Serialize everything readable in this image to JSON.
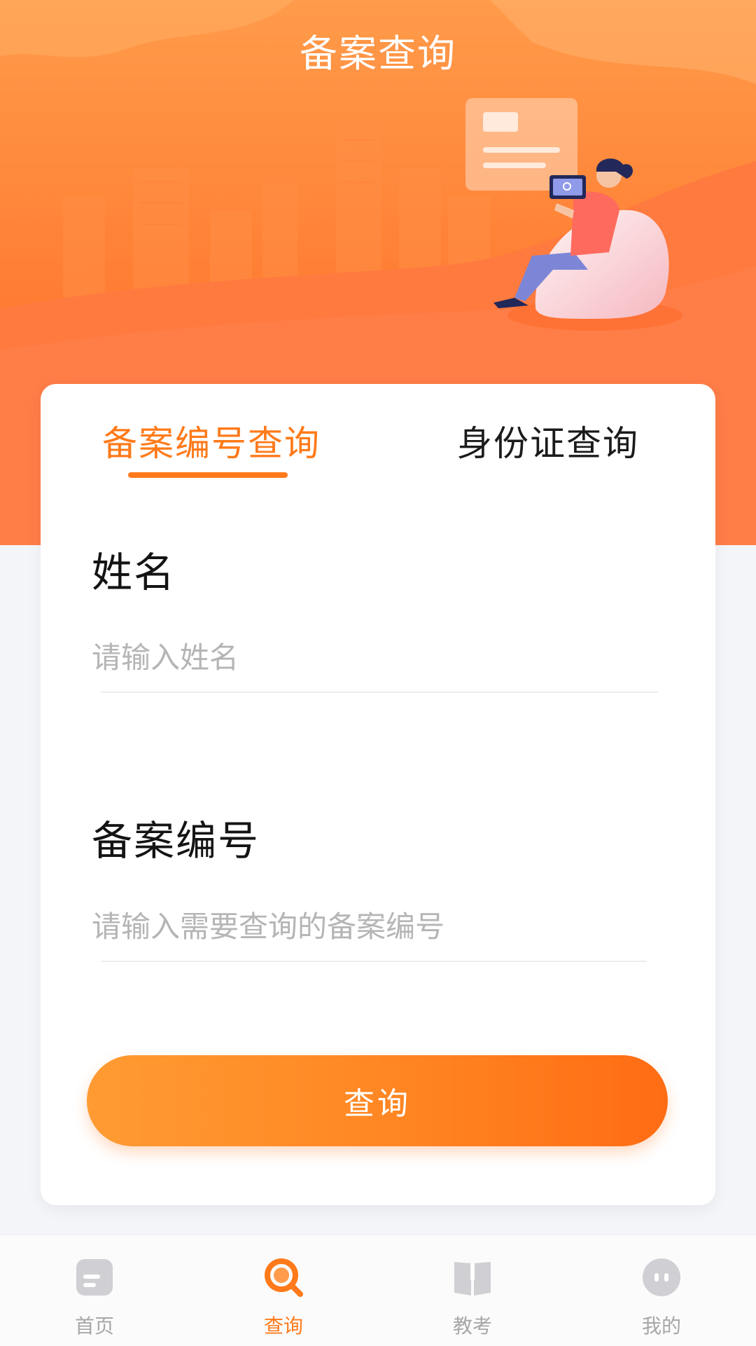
{
  "header": {
    "title": "备案查询"
  },
  "tabs": [
    {
      "label": "备案编号查询",
      "active": true
    },
    {
      "label": "身份证查询",
      "active": false
    }
  ],
  "form": {
    "name": {
      "label": "姓名",
      "placeholder": "请输入姓名",
      "value": ""
    },
    "record_number": {
      "label": "备案编号",
      "placeholder": "请输入需要查询的备案编号",
      "value": ""
    },
    "submit_label": "查询"
  },
  "bottom_nav": [
    {
      "label": "首页",
      "icon": "home-icon",
      "active": false
    },
    {
      "label": "查询",
      "icon": "search-icon",
      "active": true
    },
    {
      "label": "教考",
      "icon": "book-icon",
      "active": false
    },
    {
      "label": "我的",
      "icon": "profile-icon",
      "active": false
    }
  ],
  "colors": {
    "accent": "#ff7a1a",
    "header_top": "#ff9b4a",
    "header_bottom": "#ff7a45",
    "inactive_nav": "#a7a7a7"
  }
}
